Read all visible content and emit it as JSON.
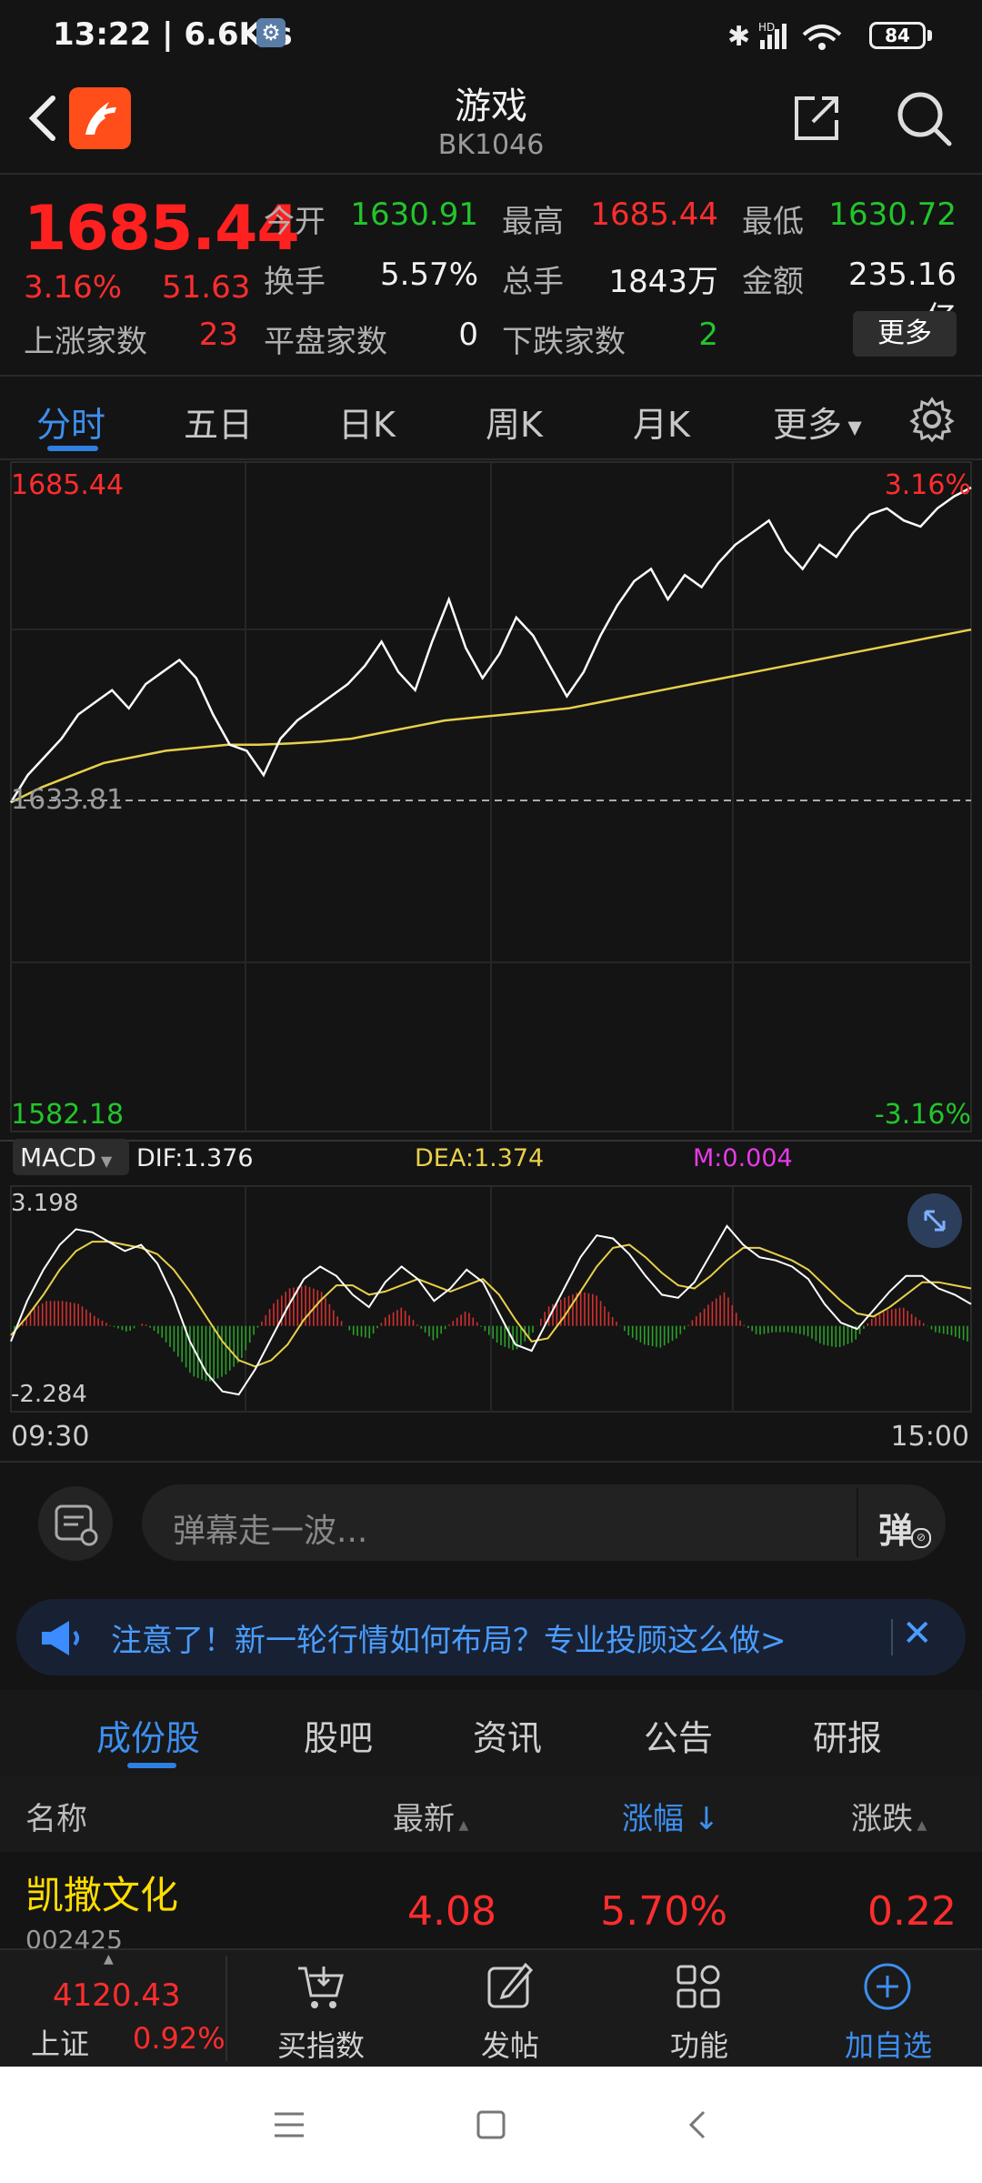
{
  "status_bar": {
    "time": "13:22 | 6.6K/s",
    "battery": "84",
    "network": "HD"
  },
  "header": {
    "title": "游戏",
    "code": "BK1046"
  },
  "quote": {
    "price": "1685.44",
    "change_pct": "3.16%",
    "change": "51.63",
    "open_label": "今开",
    "open": "1630.91",
    "high_label": "最高",
    "high": "1685.44",
    "low_label": "最低",
    "low": "1630.72",
    "turnover_label": "换手",
    "turnover": "5.57%",
    "volume_label": "总手",
    "volume": "1843万",
    "amount_label": "金额",
    "amount": "235.16亿",
    "up_label": "上涨家数",
    "up": "23",
    "flat_label": "平盘家数",
    "flat": "0",
    "down_label": "下跌家数",
    "down": "2",
    "more_label": "更多"
  },
  "period_tabs": [
    {
      "label": "分时"
    },
    {
      "label": "五日"
    },
    {
      "label": "日K"
    },
    {
      "label": "周K"
    },
    {
      "label": "月K"
    },
    {
      "label": "更多"
    }
  ],
  "chart_data": [
    {
      "type": "line",
      "series": [
        {
          "values": [
            1633.5,
            1638,
            1641,
            1644,
            1648,
            1650,
            1652,
            1649,
            1653,
            1655,
            1657,
            1654,
            1648,
            1643,
            1642,
            1638,
            1644,
            1647,
            1649,
            1651,
            1653,
            1656,
            1660,
            1655,
            1652,
            1660,
            1667,
            1659,
            1654,
            1658,
            1664,
            1661,
            1656,
            1651,
            1655,
            1661,
            1666,
            1670,
            1672,
            1667,
            1671,
            1669,
            1673,
            1676,
            1678,
            1680,
            1675,
            1672,
            1676,
            1674,
            1678,
            1681,
            1682,
            1680,
            1679,
            1682,
            1684,
            1685.44
          ]
        },
        {
          "values": [
            1633.5,
            1636,
            1638,
            1640,
            1641,
            1642,
            1642.5,
            1643,
            1643,
            1643.2,
            1643.5,
            1644,
            1645,
            1646,
            1647,
            1647.5,
            1648,
            1648.5,
            1649,
            1650,
            1651,
            1652,
            1653,
            1654,
            1655,
            1656,
            1657,
            1658,
            1659,
            1660,
            1661,
            1662
          ]
        }
      ],
      "ylim": [
        1582.18,
        1685.44
      ],
      "y_ticks": [
        "1685.44",
        "1633.81",
        "1582.18"
      ],
      "right_ticks": [
        "3.16%",
        "-3.16%"
      ],
      "reference_line": 1633.81,
      "x_ticks": [
        "09:30",
        "15:00"
      ]
    },
    {
      "type": "bar",
      "title": "MACD",
      "dif_label": "DIF:1.376",
      "dea_label": "DEA:1.374",
      "m_label": "M:0.004",
      "ylim": [
        -2.284,
        3.198
      ],
      "y_ticks": [
        "3.198",
        "-2.284"
      ],
      "series": [
        {
          "name": "DIF",
          "values": [
            -0.5,
            0.8,
            1.8,
            2.6,
            3.1,
            3.0,
            2.7,
            2.4,
            2.6,
            2.0,
            0.9,
            -0.5,
            -1.5,
            -2.1,
            -2.2,
            -1.4,
            -0.4,
            0.6,
            1.5,
            1.9,
            1.6,
            1.0,
            0.6,
            1.4,
            1.9,
            1.5,
            0.8,
            1.2,
            1.8,
            1.4,
            0.4,
            -0.6,
            -0.8,
            0.2,
            1.2,
            2.2,
            2.9,
            2.8,
            2.3,
            1.6,
            1.0,
            0.9,
            1.4,
            2.3,
            3.2,
            2.6,
            2.2,
            2.1,
            1.9,
            1.5,
            0.7,
            0.1,
            -0.1,
            0.5,
            1.1,
            1.6,
            1.6,
            1.2,
            1.0,
            0.7
          ]
        },
        {
          "name": "DEA",
          "values": [
            -0.3,
            0.3,
            1.0,
            1.8,
            2.4,
            2.7,
            2.7,
            2.6,
            2.5,
            2.3,
            1.8,
            1.1,
            0.3,
            -0.5,
            -1.1,
            -1.3,
            -1.1,
            -0.6,
            0.2,
            0.8,
            1.3,
            1.3,
            1.0,
            1.1,
            1.3,
            1.5,
            1.3,
            1.1,
            1.3,
            1.5,
            1.0,
            0.2,
            -0.5,
            -0.4,
            0.3,
            1.1,
            1.9,
            2.5,
            2.6,
            2.2,
            1.7,
            1.3,
            1.2,
            1.6,
            2.1,
            2.5,
            2.5,
            2.3,
            2.1,
            1.8,
            1.3,
            0.8,
            0.4,
            0.3,
            0.6,
            1.0,
            1.4,
            1.4,
            1.3,
            1.2
          ]
        },
        {
          "name": "M",
          "values": [
            -0.2,
            0.5,
            0.8,
            0.8,
            0.7,
            0.3,
            0.0,
            -0.2,
            0.1,
            -0.3,
            -0.9,
            -1.6,
            -1.8,
            -1.6,
            -1.1,
            -0.1,
            0.7,
            1.2,
            1.3,
            1.1,
            0.3,
            -0.3,
            -0.4,
            0.3,
            0.6,
            0.0,
            -0.5,
            0.1,
            0.5,
            -0.1,
            -0.6,
            -0.8,
            -0.3,
            0.6,
            0.9,
            1.1,
            1.0,
            0.3,
            -0.3,
            -0.6,
            -0.7,
            -0.4,
            0.2,
            0.7,
            1.1,
            0.1,
            -0.3,
            -0.2,
            -0.2,
            -0.3,
            -0.6,
            -0.7,
            -0.5,
            0.2,
            0.5,
            0.6,
            0.2,
            -0.2,
            -0.3,
            -0.5
          ]
        }
      ]
    }
  ],
  "chat": {
    "placeholder": "弹幕走一波...",
    "danmu_label": "弹"
  },
  "banner": {
    "text": "注意了！新一轮行情如何布局？专业投顾这么做>"
  },
  "section_tabs": [
    {
      "label": "成份股"
    },
    {
      "label": "股吧"
    },
    {
      "label": "资讯"
    },
    {
      "label": "公告"
    },
    {
      "label": "研报"
    }
  ],
  "table": {
    "headers": {
      "name": "名称",
      "latest": "最新",
      "change_pct": "涨幅",
      "change": "涨跌"
    },
    "rows": [
      {
        "name": "凯撒文化",
        "code": "002425",
        "latest": "4.08",
        "change_pct": "5.70%",
        "change": "0.22"
      }
    ]
  },
  "bottom_nav": {
    "index_value": "4120.43",
    "index_name": "上证",
    "index_pct": "0.92%",
    "items": [
      {
        "label": "买指数"
      },
      {
        "label": "发帖"
      },
      {
        "label": "功能"
      },
      {
        "label": "加自选"
      }
    ]
  },
  "colors": {
    "up": "#ff2d2d",
    "down": "#22c52c",
    "accent": "#2f7fe0",
    "avg_line": "#e8d04a"
  }
}
